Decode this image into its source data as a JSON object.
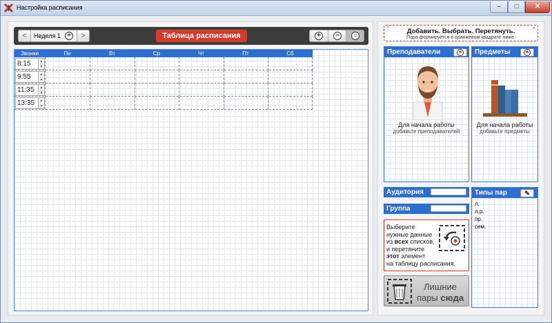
{
  "window": {
    "title": "Настройка расписания",
    "min": "–",
    "max": "□",
    "close": "✕"
  },
  "toolbar": {
    "prev": "<",
    "week_label": "Неделя 1",
    "add": "+",
    "next": ">",
    "title": "Таблица расписания",
    "zoom_in": "+",
    "zoom_out": "−",
    "zoom_reset": "○"
  },
  "table": {
    "headers": [
      "Звонки",
      "Пн",
      "Вт",
      "Ср",
      "Чт",
      "Пт",
      "Сб"
    ],
    "rows": [
      {
        "time": "8:15"
      },
      {
        "time": "9:55"
      },
      {
        "time": "11:35"
      },
      {
        "time": "13:35"
      }
    ],
    "spin_up": "▲",
    "spin_down": "▼"
  },
  "hint": {
    "title": "Добавить. Выбрать. Перетянуть.",
    "subtitle": "Пара формируется в оранжевом квадрате ниже.",
    "help": "?",
    "close": "×"
  },
  "teachers": {
    "title": "Преподаватели",
    "add": "+",
    "empty_title": "Для начала работы",
    "empty_sub": "добавьте преподавателей"
  },
  "subjects": {
    "title": "Предметы",
    "add": "+",
    "empty_title": "Для начала работы",
    "empty_sub": "добавьте предметы"
  },
  "auditorium": {
    "label": "Аудитория"
  },
  "group": {
    "label": "Группа"
  },
  "pair_types": {
    "title": "Типы пар",
    "edit": "✎",
    "items": [
      "л.",
      "л.р.",
      "пр.",
      "сем."
    ]
  },
  "instructions": {
    "line1": "Выберите",
    "line2": "нужные данные",
    "line3a": "из ",
    "line3b": "всех",
    "line3c": " списков,",
    "line4": "и перетяните",
    "line5a": "этот",
    "line5b": " элемент",
    "line6": "на таблицу расписания."
  },
  "trash": {
    "line1": "Лишние",
    "line2a": "пары ",
    "line2b": "сюда"
  },
  "colors": {
    "accent_blue": "#2c6fd0",
    "accent_red": "#d63b2c"
  },
  "icons": {
    "app": "app-icon",
    "teacher": "teacher-avatar-icon",
    "books": "books-icon",
    "drag": "drag-icon",
    "trash": "trash-icon"
  }
}
